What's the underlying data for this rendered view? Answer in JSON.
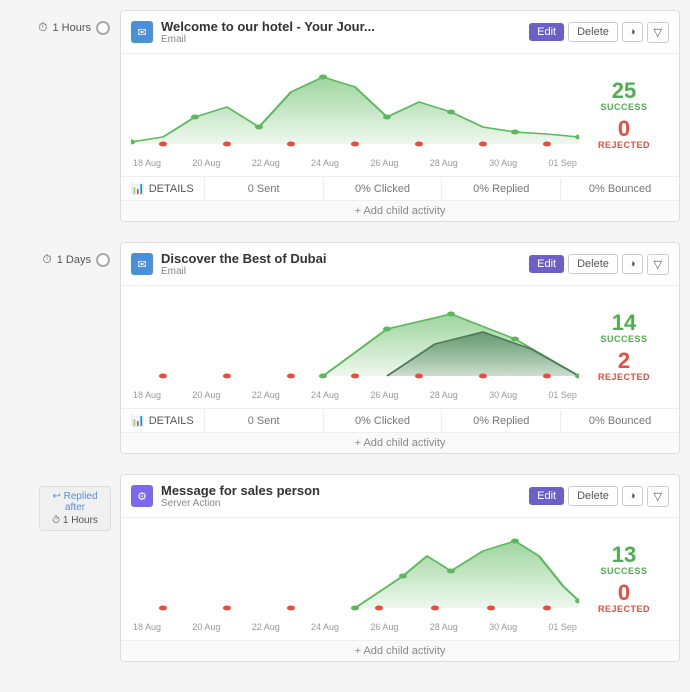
{
  "activities": [
    {
      "id": "activity-1",
      "timeline_label": "1 Hours",
      "title": "Welcome to our hotel - Your Jour...",
      "type": "Email",
      "type_icon": "email",
      "stats": {
        "success": 25,
        "rejected": 0
      },
      "chart_dates": [
        "18 Aug",
        "20 Aug",
        "22 Aug",
        "24 Aug",
        "26 Aug",
        "28 Aug",
        "30 Aug",
        "01 Sep"
      ],
      "footer": {
        "sent": "0 Sent",
        "clicked": "0% Clicked",
        "replied": "0% Replied",
        "bounced": "0% Bounced",
        "details_label": "DETAILS"
      },
      "add_child_label": "+ Add child activity"
    },
    {
      "id": "activity-2",
      "timeline_label": "1 Days",
      "title": "Discover the Best of Dubai",
      "type": "Email",
      "type_icon": "email",
      "stats": {
        "success": 14,
        "rejected": 2
      },
      "chart_dates": [
        "18 Aug",
        "20 Aug",
        "22 Aug",
        "24 Aug",
        "26 Aug",
        "28 Aug",
        "30 Aug",
        "01 Sep"
      ],
      "footer": {
        "sent": "0 Sent",
        "clicked": "0% Clicked",
        "replied": "0% Replied",
        "bounced": "0% Bounced",
        "details_label": "DETAILS"
      },
      "add_child_label": "+ Add child activity"
    },
    {
      "id": "activity-3",
      "is_child": true,
      "replied_after_label": "Replied after",
      "timeline_label": "1 Hours",
      "title": "Message for sales person",
      "type": "Server Action",
      "type_icon": "server",
      "stats": {
        "success": 13,
        "rejected": 0
      },
      "chart_dates": [
        "18 Aug",
        "20 Aug",
        "22 Aug",
        "24 Aug",
        "26 Aug",
        "28 Aug",
        "30 Aug",
        "01 Sep"
      ],
      "add_child_label": "+ Add child activity"
    }
  ],
  "buttons": {
    "edit": "Edit",
    "delete": "Delete"
  },
  "icons": {
    "clock": "🕐",
    "pie": "◑",
    "funnel": "▽",
    "bar_chart": "📊",
    "envelope": "✉",
    "server": "⚙",
    "reply_arrow": "↩"
  }
}
